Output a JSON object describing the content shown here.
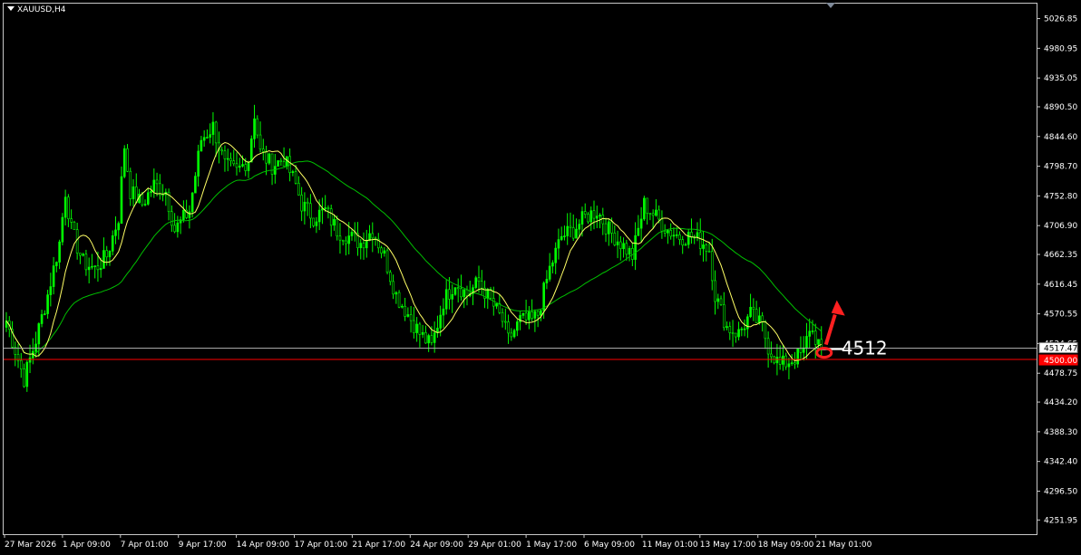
{
  "symbol": "XAUUSD,H4",
  "colors": {
    "background": "#000000",
    "candle": "#00ff00",
    "ma_fast": "#ffff66",
    "ma_slow": "#00c000",
    "support_line": "#ff0000",
    "current_line": "#b4b4b4",
    "annotation": "#ff2020",
    "text": "#ffffff"
  },
  "annotation_label": "4512",
  "price_box_current": "4517.47",
  "price_box_level": "4500.00",
  "chart_data": {
    "type": "candlestick",
    "title": "",
    "y_ticks": [
      "5026.85",
      "4980.95",
      "4935.05",
      "4890.50",
      "4844.60",
      "4798.70",
      "4752.80",
      "4706.90",
      "4662.35",
      "4616.45",
      "4570.55",
      "4524.65",
      "4478.75",
      "4434.20",
      "4388.30",
      "4342.40",
      "4296.50",
      "4251.95"
    ],
    "x_ticks": [
      "27 Mar 2026",
      "1 Apr 09:00",
      "7 Apr 01:00",
      "9 Apr 17:00",
      "14 Apr 09:00",
      "17 Apr 01:00",
      "21 Apr 17:00",
      "24 Apr 09:00",
      "29 Apr 01:00",
      "1 May 17:00",
      "6 May 09:00",
      "11 May 01:00",
      "13 May 17:00",
      "18 May 09:00",
      "21 May 01:00"
    ],
    "ylim": [
      4230.0,
      5050.0
    ],
    "current_price": 4517.47,
    "support_level": 4500.0,
    "close_anchors": [
      [
        0,
        4560
      ],
      [
        6,
        4470
      ],
      [
        10,
        4530
      ],
      [
        14,
        4600
      ],
      [
        18,
        4680
      ],
      [
        20,
        4760
      ],
      [
        22,
        4700
      ],
      [
        26,
        4650
      ],
      [
        30,
        4640
      ],
      [
        34,
        4660
      ],
      [
        38,
        4720
      ],
      [
        40,
        4830
      ],
      [
        42,
        4760
      ],
      [
        46,
        4740
      ],
      [
        50,
        4770
      ],
      [
        54,
        4760
      ],
      [
        57,
        4700
      ],
      [
        62,
        4730
      ],
      [
        66,
        4840
      ],
      [
        70,
        4860
      ],
      [
        74,
        4800
      ],
      [
        78,
        4790
      ],
      [
        82,
        4810
      ],
      [
        84,
        4880
      ],
      [
        86,
        4820
      ],
      [
        90,
        4800
      ],
      [
        94,
        4810
      ],
      [
        98,
        4770
      ],
      [
        100,
        4740
      ],
      [
        104,
        4720
      ],
      [
        108,
        4730
      ],
      [
        112,
        4700
      ],
      [
        116,
        4690
      ],
      [
        120,
        4680
      ],
      [
        124,
        4700
      ],
      [
        128,
        4660
      ],
      [
        132,
        4600
      ],
      [
        136,
        4570
      ],
      [
        140,
        4540
      ],
      [
        144,
        4520
      ],
      [
        148,
        4590
      ],
      [
        152,
        4620
      ],
      [
        156,
        4600
      ],
      [
        160,
        4620
      ],
      [
        164,
        4590
      ],
      [
        168,
        4560
      ],
      [
        170,
        4530
      ],
      [
        174,
        4560
      ],
      [
        178,
        4560
      ],
      [
        180,
        4570
      ],
      [
        184,
        4640
      ],
      [
        188,
        4690
      ],
      [
        192,
        4700
      ],
      [
        196,
        4720
      ],
      [
        200,
        4730
      ],
      [
        204,
        4700
      ],
      [
        208,
        4680
      ],
      [
        212,
        4660
      ],
      [
        216,
        4740
      ],
      [
        220,
        4720
      ],
      [
        224,
        4700
      ],
      [
        228,
        4690
      ],
      [
        232,
        4690
      ],
      [
        236,
        4680
      ],
      [
        238,
        4670
      ],
      [
        240,
        4600
      ],
      [
        244,
        4550
      ],
      [
        248,
        4540
      ],
      [
        252,
        4570
      ],
      [
        256,
        4550
      ],
      [
        258,
        4520
      ],
      [
        262,
        4490
      ],
      [
        266,
        4500
      ],
      [
        270,
        4510
      ],
      [
        272,
        4550
      ],
      [
        276,
        4517
      ]
    ],
    "series": [
      {
        "name": "",
        "kind": "candles"
      },
      {
        "name": "",
        "kind": "fast-ma"
      },
      {
        "name": "",
        "kind": "slow-ma"
      }
    ]
  }
}
